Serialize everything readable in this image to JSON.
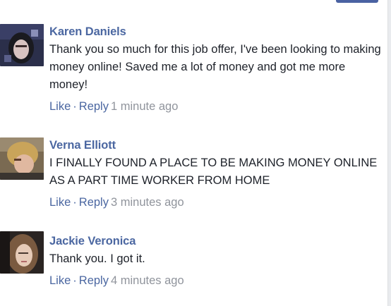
{
  "comments": [
    {
      "author": "Karen Daniels",
      "text": "Thank you so much for this job offer, I've been looking to making money online! Saved me a lot of money and got me more money!",
      "like_label": "Like",
      "separator": "·",
      "reply_label": "Reply",
      "time": "1 minute ago"
    },
    {
      "author": "Verna Elliott",
      "text": "I FINALLY FOUND A PLACE TO BE MAKING MONEY ONLINE AS A PART TIME WORKER FROM HOME",
      "like_label": "Like",
      "separator": "·",
      "reply_label": "Reply",
      "time": "3 minutes ago"
    },
    {
      "author": "Jackie Veronica",
      "text": "Thank you. I got it.",
      "like_label": "Like",
      "separator": "·",
      "reply_label": "Reply",
      "time": "4 minutes ago"
    }
  ],
  "colors": {
    "author_link": "#4b67a1",
    "body_text": "#1d2129",
    "timestamp": "#90949c"
  }
}
